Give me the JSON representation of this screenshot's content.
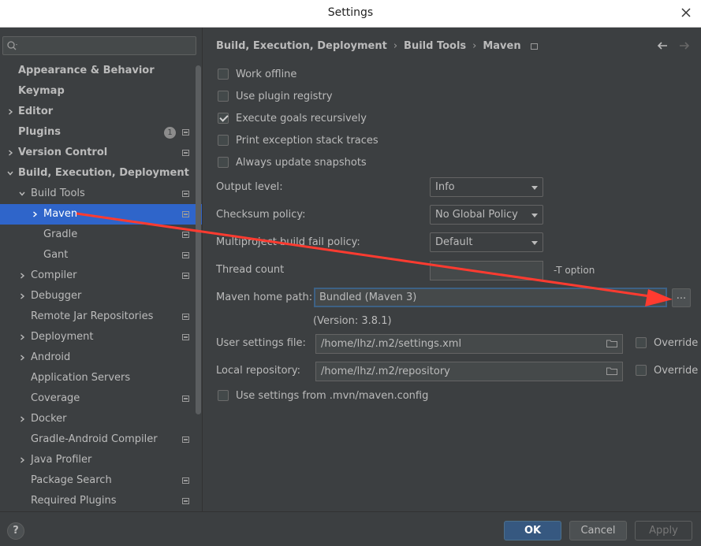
{
  "window": {
    "title": "Settings"
  },
  "sidebar": {
    "search_placeholder": "",
    "items": [
      {
        "label": "Appearance & Behavior",
        "bold": true,
        "expander": "",
        "level": 0
      },
      {
        "label": "Keymap",
        "bold": true,
        "expander": "",
        "level": 0
      },
      {
        "label": "Editor",
        "bold": true,
        "expander": "collapsed",
        "level": 0
      },
      {
        "label": "Plugins",
        "bold": true,
        "expander": "",
        "level": 0,
        "badge": "1",
        "project": true
      },
      {
        "label": "Version Control",
        "bold": true,
        "expander": "collapsed",
        "level": 0,
        "project": true
      },
      {
        "label": "Build, Execution, Deployment",
        "bold": true,
        "expander": "expanded",
        "level": 0
      },
      {
        "label": "Build Tools",
        "expander": "expanded",
        "level": 1,
        "project": true
      },
      {
        "label": "Maven",
        "expander": "collapsed",
        "level": 2,
        "project": true,
        "selected": true
      },
      {
        "label": "Gradle",
        "expander": "",
        "level": 2,
        "project": true
      },
      {
        "label": "Gant",
        "expander": "",
        "level": 2,
        "project": true
      },
      {
        "label": "Compiler",
        "expander": "collapsed",
        "level": 1,
        "project": true
      },
      {
        "label": "Debugger",
        "expander": "collapsed",
        "level": 1
      },
      {
        "label": "Remote Jar Repositories",
        "expander": "",
        "level": 1,
        "project": true
      },
      {
        "label": "Deployment",
        "expander": "collapsed",
        "level": 1,
        "project": true
      },
      {
        "label": "Android",
        "expander": "collapsed",
        "level": 1
      },
      {
        "label": "Application Servers",
        "expander": "",
        "level": 1
      },
      {
        "label": "Coverage",
        "expander": "",
        "level": 1,
        "project": true
      },
      {
        "label": "Docker",
        "expander": "collapsed",
        "level": 1
      },
      {
        "label": "Gradle-Android Compiler",
        "expander": "",
        "level": 1,
        "project": true
      },
      {
        "label": "Java Profiler",
        "expander": "collapsed",
        "level": 1
      },
      {
        "label": "Package Search",
        "expander": "",
        "level": 1,
        "project": true
      },
      {
        "label": "Required Plugins",
        "expander": "",
        "level": 1,
        "project": true
      }
    ]
  },
  "breadcrumb": {
    "parts": [
      "Build, Execution, Deployment",
      "Build Tools",
      "Maven"
    ]
  },
  "options": [
    {
      "label": "Work offline",
      "checked": false
    },
    {
      "label": "Use plugin registry",
      "checked": false
    },
    {
      "label": "Execute goals recursively",
      "checked": true
    },
    {
      "label": "Print exception stack traces",
      "checked": false
    },
    {
      "label": "Always update snapshots",
      "checked": false
    }
  ],
  "form": {
    "output_level": {
      "label": "Output level:",
      "value": "Info"
    },
    "checksum_policy": {
      "label": "Checksum policy:",
      "value": "No Global Policy"
    },
    "fail_policy": {
      "label": "Multiproject build fail policy:",
      "value": "Default"
    },
    "thread_count": {
      "label": "Thread count",
      "value": "",
      "hint": "-T option"
    },
    "maven_home": {
      "label": "Maven home path:",
      "value": "Bundled (Maven 3)",
      "browse": "...",
      "version": "(Version: 3.8.1)"
    },
    "user_settings": {
      "label": "User settings file:",
      "value": "/home/lhz/.m2/settings.xml",
      "override": "Override"
    },
    "local_repo": {
      "label": "Local repository:",
      "value": "/home/lhz/.m2/repository",
      "override": "Override"
    },
    "mvn_config": {
      "label": "Use settings from .mvn/maven.config",
      "checked": false
    }
  },
  "footer": {
    "help": "?",
    "ok": "OK",
    "cancel": "Cancel",
    "apply": "Apply"
  },
  "colors": {
    "selection": "#2f65ca",
    "annotation_arrow": "#ff3b30",
    "primary_button": "#365880"
  }
}
